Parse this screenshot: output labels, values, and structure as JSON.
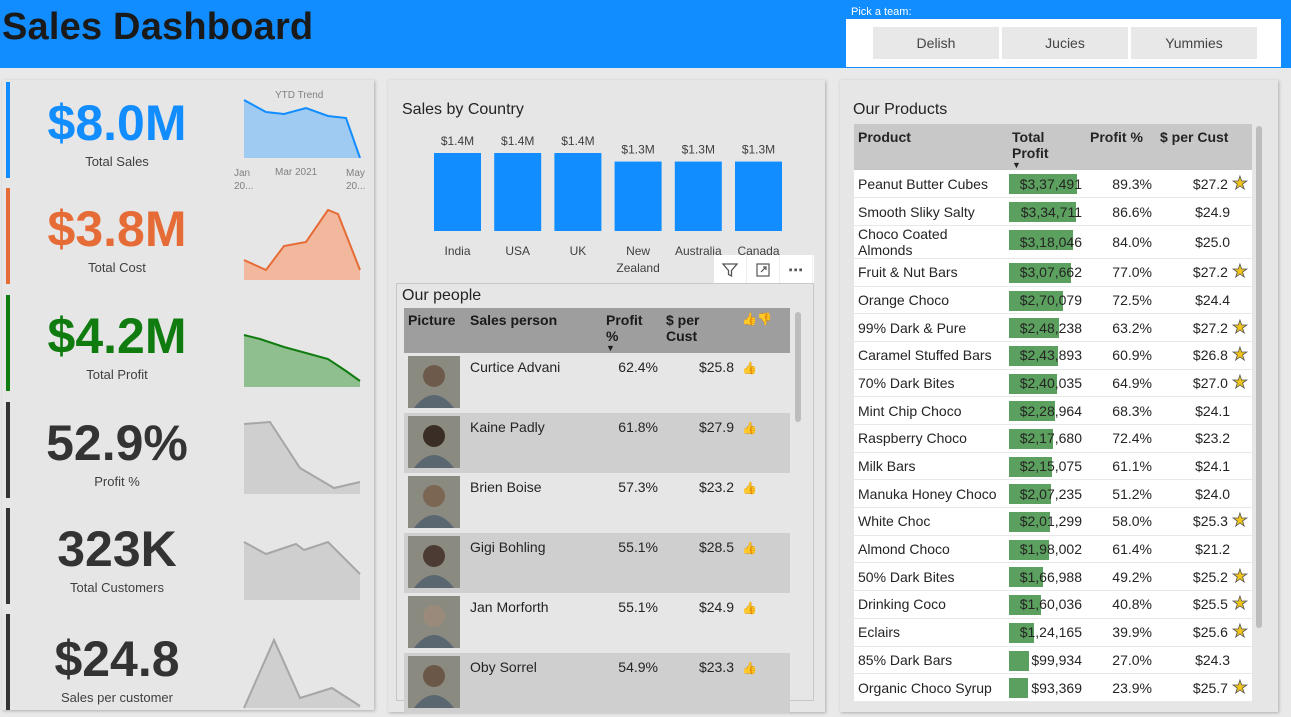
{
  "header": {
    "title": "Sales Dashboard",
    "team_label": "Pick a team:",
    "teams": [
      "Delish",
      "Jucies",
      "Yummies"
    ]
  },
  "kpis": [
    {
      "value": "$8.0M",
      "label": "Total Sales",
      "color": "#118dff"
    },
    {
      "value": "$3.8M",
      "label": "Total Cost",
      "color": "#e66c37"
    },
    {
      "value": "$4.2M",
      "label": "Total Profit",
      "color": "#107c10"
    },
    {
      "value": "52.9%",
      "label": "Profit %",
      "color": "#333333"
    },
    {
      "value": "323K",
      "label": "Total Customers",
      "color": "#333333"
    },
    {
      "value": "$24.8",
      "label": "Sales per customer",
      "color": "#333333"
    }
  ],
  "ytd": {
    "title": "YTD Trend",
    "axis": [
      "Jan 20...",
      "Mar 2021",
      "May 20..."
    ]
  },
  "sales_by_country": {
    "title": "Sales by Country",
    "chart_data": {
      "type": "bar",
      "categories": [
        "India",
        "USA",
        "UK",
        "New Zealand",
        "Australia",
        "Canada"
      ],
      "values": [
        1.4,
        1.4,
        1.4,
        1.3,
        1.3,
        1.3
      ],
      "data_labels": [
        "$1.4M",
        "$1.4M",
        "$1.4M",
        "$1.3M",
        "$1.3M",
        "$1.3M"
      ],
      "title": "Sales by Country",
      "color": "#118dff"
    }
  },
  "people": {
    "title": "Our people",
    "columns": [
      "Picture",
      "Sales person",
      "Profit %",
      "$ per Cust",
      "👍👎"
    ],
    "rows": [
      {
        "name": "Curtice Advani",
        "profit": "62.4%",
        "per_cust": "$25.8"
      },
      {
        "name": "Kaine Padly",
        "profit": "61.8%",
        "per_cust": "$27.9"
      },
      {
        "name": "Brien Boise",
        "profit": "57.3%",
        "per_cust": "$23.2"
      },
      {
        "name": "Gigi Bohling",
        "profit": "55.1%",
        "per_cust": "$28.5"
      },
      {
        "name": "Jan Morforth",
        "profit": "55.1%",
        "per_cust": "$24.9"
      },
      {
        "name": "Oby Sorrel",
        "profit": "54.9%",
        "per_cust": "$23.3"
      }
    ]
  },
  "products": {
    "title": "Our Products",
    "columns": [
      "Product",
      "Total Profit",
      "Profit %",
      "$ per Cust"
    ],
    "rows": [
      {
        "name": "Peanut Butter Cubes",
        "profit": "$3,37,491",
        "profit_value": 337491,
        "pct": "89.3%",
        "per_cust": "$27.2",
        "star": true
      },
      {
        "name": "Smooth Sliky Salty",
        "profit": "$3,34,711",
        "profit_value": 334711,
        "pct": "86.6%",
        "per_cust": "$24.9",
        "star": false
      },
      {
        "name": "Choco Coated Almonds",
        "profit": "$3,18,046",
        "profit_value": 318046,
        "pct": "84.0%",
        "per_cust": "$25.0",
        "star": false
      },
      {
        "name": "Fruit & Nut Bars",
        "profit": "$3,07,662",
        "profit_value": 307662,
        "pct": "77.0%",
        "per_cust": "$27.2",
        "star": true
      },
      {
        "name": "Orange Choco",
        "profit": "$2,70,079",
        "profit_value": 270079,
        "pct": "72.5%",
        "per_cust": "$24.4",
        "star": false
      },
      {
        "name": "99% Dark & Pure",
        "profit": "$2,48,238",
        "profit_value": 248238,
        "pct": "63.2%",
        "per_cust": "$27.2",
        "star": true
      },
      {
        "name": "Caramel Stuffed Bars",
        "profit": "$2,43,893",
        "profit_value": 243893,
        "pct": "60.9%",
        "per_cust": "$26.8",
        "star": true
      },
      {
        "name": "70% Dark Bites",
        "profit": "$2,40,035",
        "profit_value": 240035,
        "pct": "64.9%",
        "per_cust": "$27.0",
        "star": true
      },
      {
        "name": "Mint Chip Choco",
        "profit": "$2,28,964",
        "profit_value": 228964,
        "pct": "68.3%",
        "per_cust": "$24.1",
        "star": false
      },
      {
        "name": "Raspberry Choco",
        "profit": "$2,17,680",
        "profit_value": 217680,
        "pct": "72.4%",
        "per_cust": "$23.2",
        "star": false
      },
      {
        "name": "Milk Bars",
        "profit": "$2,15,075",
        "profit_value": 215075,
        "pct": "61.1%",
        "per_cust": "$24.1",
        "star": false
      },
      {
        "name": "Manuka Honey Choco",
        "profit": "$2,07,235",
        "profit_value": 207235,
        "pct": "51.2%",
        "per_cust": "$24.0",
        "star": false
      },
      {
        "name": "White Choc",
        "profit": "$2,01,299",
        "profit_value": 201299,
        "pct": "58.0%",
        "per_cust": "$25.3",
        "star": true
      },
      {
        "name": "Almond Choco",
        "profit": "$1,98,002",
        "profit_value": 198002,
        "pct": "61.4%",
        "per_cust": "$21.2",
        "star": false
      },
      {
        "name": "50% Dark Bites",
        "profit": "$1,66,988",
        "profit_value": 166988,
        "pct": "49.2%",
        "per_cust": "$25.2",
        "star": true
      },
      {
        "name": "Drinking Coco",
        "profit": "$1,60,036",
        "profit_value": 160036,
        "pct": "40.8%",
        "per_cust": "$25.5",
        "star": true
      },
      {
        "name": "Eclairs",
        "profit": "$1,24,165",
        "profit_value": 124165,
        "pct": "39.9%",
        "per_cust": "$25.6",
        "star": true
      },
      {
        "name": "85% Dark Bars",
        "profit": "$99,934",
        "profit_value": 99934,
        "pct": "27.0%",
        "per_cust": "$24.3",
        "star": false
      },
      {
        "name": "Organic Choco Syrup",
        "profit": "$93,369",
        "profit_value": 93369,
        "pct": "23.9%",
        "per_cust": "$25.7",
        "star": true
      }
    ]
  }
}
